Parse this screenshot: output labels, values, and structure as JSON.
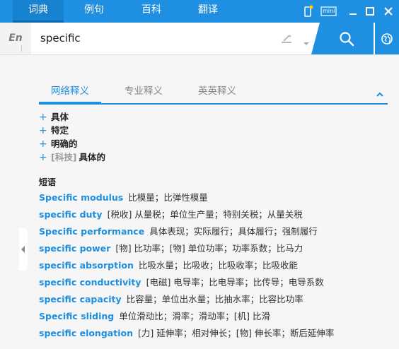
{
  "top_tabs": [
    "词典",
    "例句",
    "百科",
    "翻译"
  ],
  "mini_label": "mini",
  "search": {
    "lang": "En",
    "query": "specific"
  },
  "def_tabs": [
    "网络释义",
    "专业释义",
    "英英释义"
  ],
  "definitions": [
    {
      "tag": "",
      "text": "具体"
    },
    {
      "tag": "",
      "text": "特定"
    },
    {
      "tag": "",
      "text": "明确的"
    },
    {
      "tag": "[科技]",
      "text": "具体的"
    }
  ],
  "phrases_title": "短语",
  "phrases": [
    {
      "en": "Specific modulus",
      "zh": "比模量；比弹性模量"
    },
    {
      "en": "specific duty",
      "zh": "[税收] 从量税；单位生产量；特别关税；从量关税"
    },
    {
      "en": "Specific performance",
      "zh": "具体表现；实际履行；具体履行；强制履行"
    },
    {
      "en": "specific power",
      "zh": "[物] 比功率；[物] 单位功率；功率系数；比马力"
    },
    {
      "en": "specific absorption",
      "zh": "比吸水量；比吸收；比吸收率；比吸收能"
    },
    {
      "en": "specific conductivity",
      "zh": "[电磁] 电导率；比电导率；比传导；电导系数"
    },
    {
      "en": "specific capacity",
      "zh": "比容量；单位出水量；比抽水率；比容比功率"
    },
    {
      "en": "Specific sliding",
      "zh": "单位滑动比；滑率；滑动率；[机] 比滑"
    },
    {
      "en": "specific elongation",
      "zh": "[力] 延伸率；相对伸长；[物] 伸长率；断后延伸率"
    }
  ],
  "colors": {
    "accent": "#1e8fe1"
  }
}
